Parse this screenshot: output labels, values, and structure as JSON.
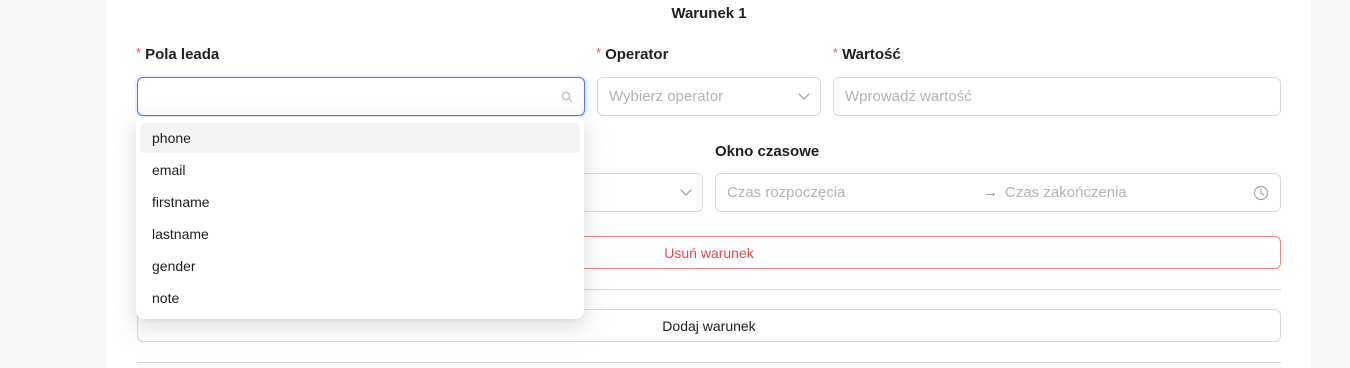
{
  "condition": {
    "title": "Warunek 1",
    "required_mark": "*",
    "lead_field": {
      "label": "Pola leada",
      "value": ""
    },
    "operator": {
      "label": "Operator",
      "placeholder": "Wybierz operator"
    },
    "value": {
      "label": "Wartość",
      "placeholder": "Wprowadź wartość"
    },
    "time_window": {
      "label": "Okno czasowe",
      "start_placeholder": "Czas rozpoczęcia",
      "separator": "→",
      "end_placeholder": "Czas zakończenia"
    },
    "remove_button": "Usuń warunek"
  },
  "add_button": "Dodaj warunek",
  "lead_field_options": [
    "phone",
    "email",
    "firstname",
    "lastname",
    "gender",
    "note"
  ],
  "active_option_index": 0,
  "colors": {
    "accent": "#4a7ee8",
    "danger": "#e14b4b",
    "border": "#d9d9d9",
    "placeholder": "#b3b3b3"
  }
}
